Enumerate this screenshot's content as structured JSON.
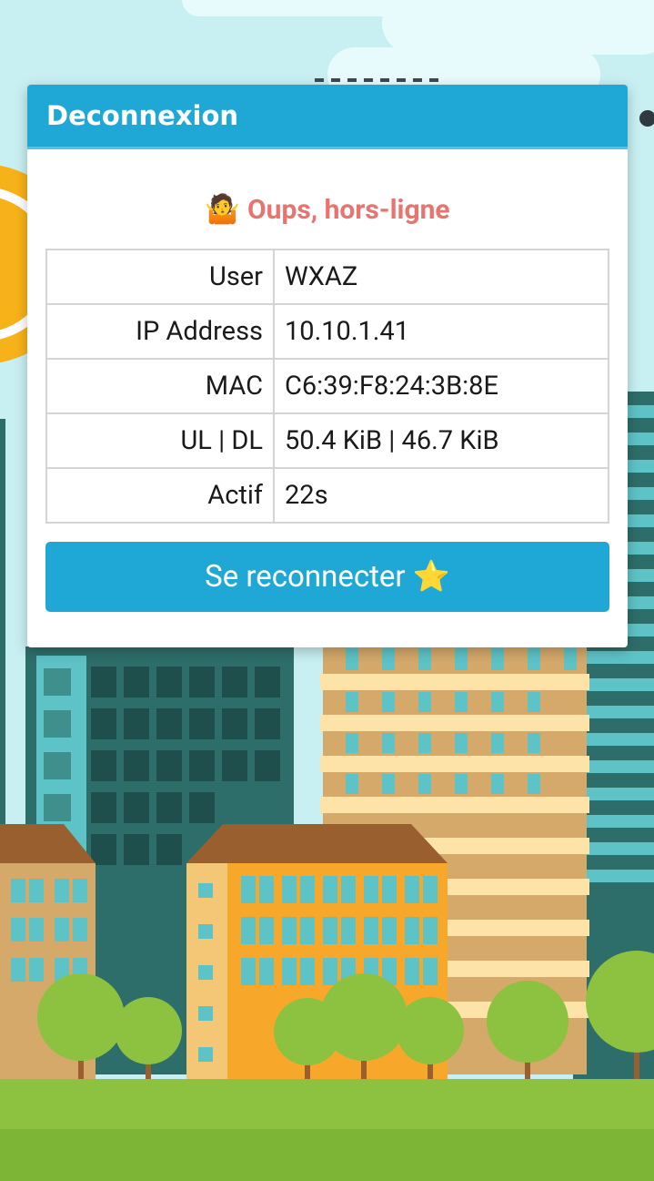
{
  "dialog": {
    "title": "Deconnexion",
    "status_emoji": "🤷",
    "status_text": "Oups, hors-ligne",
    "rows": [
      {
        "label": "User",
        "value": "WXAZ"
      },
      {
        "label": "IP Address",
        "value": "10.10.1.41"
      },
      {
        "label": "MAC",
        "value": "C6:39:F8:24:3B:8E"
      },
      {
        "label": "UL | DL",
        "value": "50.4 KiB | 46.7 KiB"
      },
      {
        "label": "Actif",
        "value": "22s"
      }
    ],
    "reconnect_label": "Se reconnecter ⭐"
  },
  "colors": {
    "header": "#1fa8d6",
    "button": "#1fa8d6",
    "status_text": "#e8736f",
    "sky": "#c8f0f2",
    "grass": "#8cc23f"
  }
}
